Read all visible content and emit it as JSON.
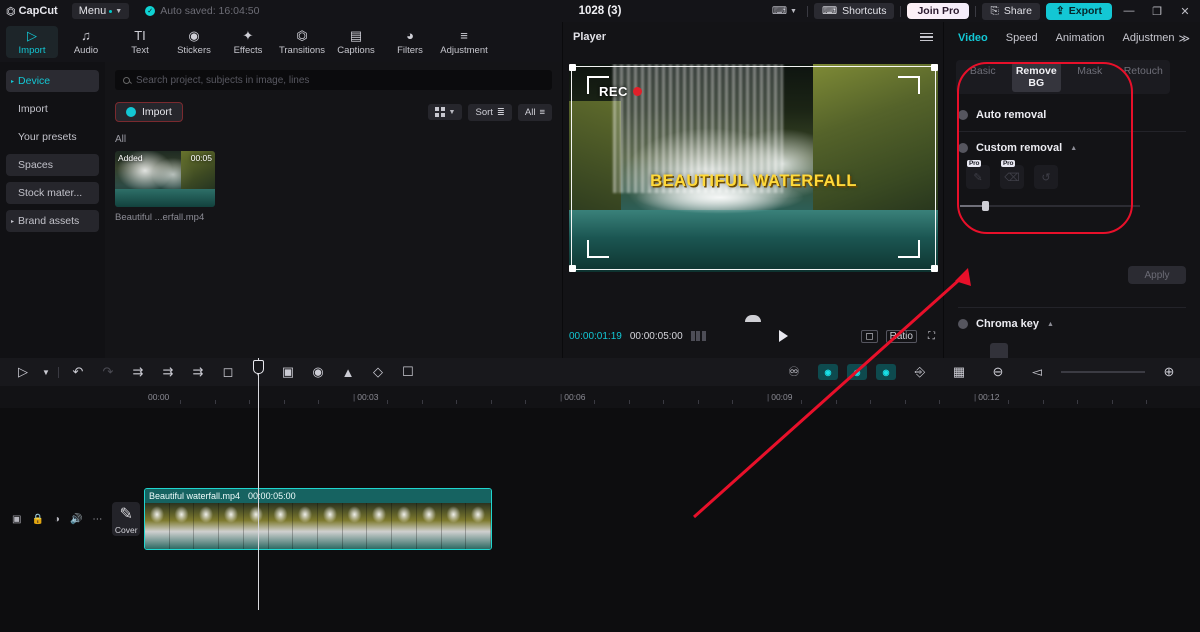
{
  "titlebar": {
    "brand": "CapCut",
    "menu_label": "Menu",
    "autosave": "Auto saved: 16:04:50",
    "project_title": "1028 (3)",
    "keyboard_icon": "keyboard-icon",
    "shortcuts_label": "Shortcuts",
    "join_pro_label": "Join Pro",
    "share_label": "Share",
    "export_label": "Export",
    "minimize": "—",
    "maximize": "❐",
    "close": "✕"
  },
  "nav": {
    "items": [
      {
        "label": "Import",
        "icon": "import-icon"
      },
      {
        "label": "Audio",
        "icon": "audio-icon"
      },
      {
        "label": "Text",
        "icon": "text-icon"
      },
      {
        "label": "Stickers",
        "icon": "stickers-icon"
      },
      {
        "label": "Effects",
        "icon": "effects-icon"
      },
      {
        "label": "Transitions",
        "icon": "transitions-icon"
      },
      {
        "label": "Captions",
        "icon": "captions-icon"
      },
      {
        "label": "Filters",
        "icon": "filters-icon"
      },
      {
        "label": "Adjustment",
        "icon": "adjustment-icon"
      }
    ],
    "active_index": 0
  },
  "sidebar": {
    "items": [
      {
        "label": "Device"
      },
      {
        "label": "Import"
      },
      {
        "label": "Your presets"
      },
      {
        "label": "Spaces"
      },
      {
        "label": "Stock mater..."
      },
      {
        "label": "Brand assets"
      }
    ]
  },
  "media": {
    "search_placeholder": "Search project, subjects in image, lines",
    "import_label": "Import",
    "sort_label": "Sort",
    "filter_label": "All",
    "group_label": "All",
    "asset": {
      "badge": "Added",
      "duration": "00:05",
      "name": "Beautiful ...erfall.mp4"
    }
  },
  "player": {
    "title": "Player",
    "overlay_rec": "REC",
    "overlay_title": "BEAUTIFUL WATERFALL",
    "current_time": "00:00:01:19",
    "total_time": "00:00:05:00",
    "ratio_label": "Ratio",
    "play_icon": "play-icon",
    "crop_icon": "crop-icon",
    "fullscreen_icon": "fullscreen-icon",
    "menu_icon": "hamburger-icon"
  },
  "right_panel": {
    "tabs": [
      {
        "label": "Video"
      },
      {
        "label": "Speed"
      },
      {
        "label": "Animation"
      },
      {
        "label": "Adjustmen"
      }
    ],
    "tabs_overflow": "≫",
    "subtabs": [
      {
        "label": "Basic"
      },
      {
        "label": "Remove BG"
      },
      {
        "label": "Mask"
      },
      {
        "label": "Retouch"
      }
    ],
    "auto_removal_label": "Auto removal",
    "custom_removal_label": "Custom removal",
    "pro_badge": "Pro",
    "apply_label": "Apply",
    "chroma_key_label": "Chroma key"
  },
  "timeline": {
    "tools": [
      "select-icon",
      "dropdown-icon",
      "undo-icon",
      "redo-icon",
      "split-left-icon",
      "split-icon",
      "split-right-icon",
      "delete-icon",
      "marker-icon",
      "freeze-icon",
      "rotate-icon",
      "mirror-icon",
      "reverse-icon",
      "crop-icon"
    ],
    "right_tools": [
      "mic-icon",
      "auto-cut-icon",
      "auto-caption-icon",
      "auto-reframe-icon",
      "split-view-icon",
      "keyframe-icon",
      "zoom-out-icon",
      "zoom-slider",
      "zoom-in-icon"
    ],
    "ruler_ticks": [
      "00:00",
      "00:03",
      "00:06",
      "00:09",
      "00:12"
    ],
    "track_icons": [
      "video-track-icon",
      "lock-icon",
      "visibility-icon",
      "mute-icon",
      "more-icon"
    ],
    "cover_label": "Cover",
    "clip": {
      "name": "Beautiful waterfall.mp4",
      "duration": "00:00:05:00"
    }
  }
}
